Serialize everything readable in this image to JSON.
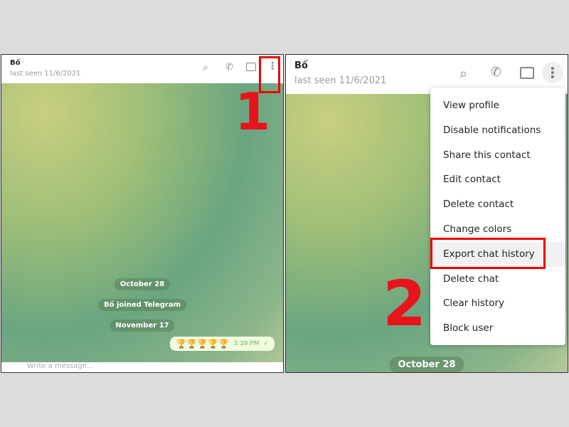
{
  "left": {
    "contact_name": "Bố",
    "last_seen": "last seen 11/6/2021",
    "service_messages": [
      "October 28",
      "Bố joined Telegram",
      "November 17"
    ],
    "message": {
      "text": "🏆🏆🏆🏆🏆",
      "time": "3:39 PM",
      "status_icon": "check-icon"
    },
    "input_placeholder": "Write a message...",
    "step_label": "1"
  },
  "right": {
    "contact_name": "Bố",
    "last_seen": "last seen 11/6/2021",
    "menu_items": [
      "View profile",
      "Disable notifications",
      "Share this contact",
      "Edit contact",
      "Delete contact",
      "Change colors",
      "Export chat history",
      "Delete chat",
      "Clear history",
      "Block user"
    ],
    "highlighted_item": "Export chat history",
    "date_pill": "October 28",
    "step_label": "2"
  },
  "colors": {
    "highlight": "#e8141c",
    "bubble": "#effdde"
  }
}
